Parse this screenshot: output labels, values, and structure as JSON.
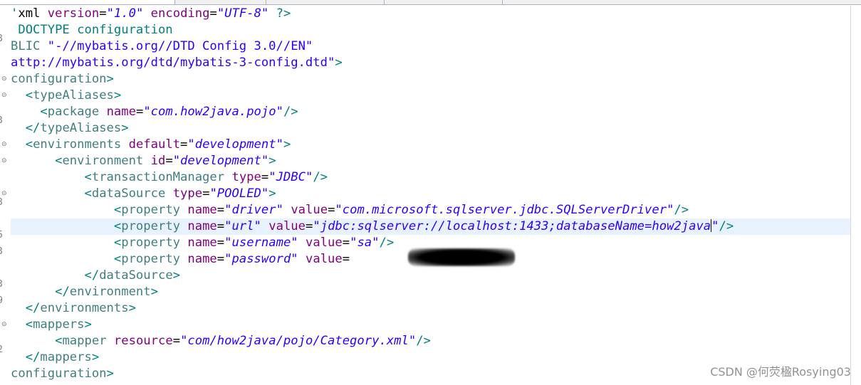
{
  "editor": {
    "lines": [
      {
        "tokens": [
          {
            "t": "punct",
            "v": "'"
          },
          {
            "t": "plain",
            "v": "xml "
          },
          {
            "t": "attr",
            "v": "version"
          },
          {
            "t": "plain",
            "v": "="
          },
          {
            "t": "val",
            "v": "\"1.0\""
          },
          {
            "t": "plain",
            "v": " "
          },
          {
            "t": "attr",
            "v": "encoding"
          },
          {
            "t": "plain",
            "v": "="
          },
          {
            "t": "val",
            "v": "\"UTF-8\""
          },
          {
            "t": "plain",
            "v": " "
          },
          {
            "t": "punct",
            "v": "?>"
          }
        ]
      },
      {
        "tokens": [
          {
            "t": "doctype",
            "v": " DOCTYPE configuration"
          }
        ]
      },
      {
        "tokens": [
          {
            "t": "dt-text",
            "v": "BLIC "
          },
          {
            "t": "dt-str",
            "v": "\"-//mybatis.org//DTD Config 3.0//EN\""
          }
        ]
      },
      {
        "tokens": [
          {
            "t": "dt-str",
            "v": "attp://mybatis.org/dtd/mybatis-3-config.dtd\""
          },
          {
            "t": "doctype",
            "v": ">"
          }
        ]
      },
      {
        "tokens": [
          {
            "t": "tag",
            "v": "configuration"
          },
          {
            "t": "punct",
            "v": ">"
          }
        ]
      },
      {
        "tokens": [
          {
            "t": "plain",
            "v": "  "
          },
          {
            "t": "punct",
            "v": "<"
          },
          {
            "t": "tag",
            "v": "typeAliases"
          },
          {
            "t": "punct",
            "v": ">"
          }
        ]
      },
      {
        "tokens": [
          {
            "t": "plain",
            "v": "    "
          },
          {
            "t": "punct",
            "v": "<"
          },
          {
            "t": "tag",
            "v": "package"
          },
          {
            "t": "plain",
            "v": " "
          },
          {
            "t": "attr",
            "v": "name"
          },
          {
            "t": "plain",
            "v": "="
          },
          {
            "t": "val",
            "v": "\"com.how2java.pojo\""
          },
          {
            "t": "punct",
            "v": "/>"
          }
        ]
      },
      {
        "tokens": [
          {
            "t": "plain",
            "v": "  "
          },
          {
            "t": "punct",
            "v": "</"
          },
          {
            "t": "tag",
            "v": "typeAliases"
          },
          {
            "t": "punct",
            "v": ">"
          }
        ]
      },
      {
        "tokens": [
          {
            "t": "plain",
            "v": "  "
          },
          {
            "t": "punct",
            "v": "<"
          },
          {
            "t": "tag",
            "v": "environments"
          },
          {
            "t": "plain",
            "v": " "
          },
          {
            "t": "attr",
            "v": "default"
          },
          {
            "t": "plain",
            "v": "="
          },
          {
            "t": "val",
            "v": "\"development\""
          },
          {
            "t": "punct",
            "v": ">"
          }
        ]
      },
      {
        "tokens": [
          {
            "t": "plain",
            "v": "      "
          },
          {
            "t": "punct",
            "v": "<"
          },
          {
            "t": "tag",
            "v": "environment"
          },
          {
            "t": "plain",
            "v": " "
          },
          {
            "t": "attr",
            "v": "id"
          },
          {
            "t": "plain",
            "v": "="
          },
          {
            "t": "val",
            "v": "\"development\""
          },
          {
            "t": "punct",
            "v": ">"
          }
        ]
      },
      {
        "tokens": [
          {
            "t": "plain",
            "v": "          "
          },
          {
            "t": "punct",
            "v": "<"
          },
          {
            "t": "tag",
            "v": "transactionManager"
          },
          {
            "t": "plain",
            "v": " "
          },
          {
            "t": "attr",
            "v": "type"
          },
          {
            "t": "plain",
            "v": "="
          },
          {
            "t": "val",
            "v": "\"JDBC\""
          },
          {
            "t": "punct",
            "v": "/>"
          }
        ]
      },
      {
        "tokens": [
          {
            "t": "plain",
            "v": "          "
          },
          {
            "t": "punct",
            "v": "<"
          },
          {
            "t": "tag",
            "v": "dataSource"
          },
          {
            "t": "plain",
            "v": " "
          },
          {
            "t": "attr",
            "v": "type"
          },
          {
            "t": "plain",
            "v": "="
          },
          {
            "t": "val",
            "v": "\"POOLED\""
          },
          {
            "t": "punct",
            "v": ">"
          }
        ]
      },
      {
        "tokens": [
          {
            "t": "plain",
            "v": "              "
          },
          {
            "t": "punct",
            "v": "<"
          },
          {
            "t": "tag",
            "v": "property"
          },
          {
            "t": "plain",
            "v": " "
          },
          {
            "t": "attr",
            "v": "name"
          },
          {
            "t": "plain",
            "v": "="
          },
          {
            "t": "val",
            "v": "\"driver\""
          },
          {
            "t": "plain",
            "v": " "
          },
          {
            "t": "attr",
            "v": "value"
          },
          {
            "t": "plain",
            "v": "="
          },
          {
            "t": "val",
            "v": "\"com.microsoft.sqlserver.jdbc.SQLServerDriver\""
          },
          {
            "t": "punct",
            "v": "/>"
          }
        ]
      },
      {
        "current": true,
        "tokens": [
          {
            "t": "plain",
            "v": "              "
          },
          {
            "t": "punct",
            "v": "<"
          },
          {
            "t": "tag",
            "v": "property"
          },
          {
            "t": "plain",
            "v": " "
          },
          {
            "t": "attr",
            "v": "name"
          },
          {
            "t": "plain",
            "v": "="
          },
          {
            "t": "val",
            "v": "\"url\""
          },
          {
            "t": "plain",
            "v": " "
          },
          {
            "t": "attr",
            "v": "value"
          },
          {
            "t": "plain",
            "v": "="
          },
          {
            "t": "val",
            "v": "\"jdbc:sqlserver://localhost:1433;databaseName=how2java"
          },
          {
            "t": "caret",
            "v": ""
          },
          {
            "t": "val",
            "v": "\""
          },
          {
            "t": "punct",
            "v": "/>"
          }
        ]
      },
      {
        "tokens": [
          {
            "t": "plain",
            "v": "              "
          },
          {
            "t": "punct",
            "v": "<"
          },
          {
            "t": "tag",
            "v": "property"
          },
          {
            "t": "plain",
            "v": " "
          },
          {
            "t": "attr",
            "v": "name"
          },
          {
            "t": "plain",
            "v": "="
          },
          {
            "t": "val",
            "v": "\"username\""
          },
          {
            "t": "plain",
            "v": " "
          },
          {
            "t": "attr",
            "v": "value"
          },
          {
            "t": "plain",
            "v": "="
          },
          {
            "t": "val",
            "v": "\"sa\""
          },
          {
            "t": "punct",
            "v": "/>"
          }
        ]
      },
      {
        "tokens": [
          {
            "t": "plain",
            "v": "              "
          },
          {
            "t": "punct",
            "v": "<"
          },
          {
            "t": "tag",
            "v": "property"
          },
          {
            "t": "plain",
            "v": " "
          },
          {
            "t": "attr",
            "v": "name"
          },
          {
            "t": "plain",
            "v": "="
          },
          {
            "t": "val",
            "v": "\"password\""
          },
          {
            "t": "plain",
            "v": " "
          },
          {
            "t": "attr",
            "v": "value"
          },
          {
            "t": "plain",
            "v": "=            "
          },
          {
            "t": "punct",
            "v": "/>"
          }
        ]
      },
      {
        "tokens": [
          {
            "t": "plain",
            "v": "          "
          },
          {
            "t": "punct",
            "v": "</"
          },
          {
            "t": "tag",
            "v": "dataSource"
          },
          {
            "t": "punct",
            "v": ">"
          }
        ]
      },
      {
        "tokens": [
          {
            "t": "plain",
            "v": "      "
          },
          {
            "t": "punct",
            "v": "</"
          },
          {
            "t": "tag",
            "v": "environment"
          },
          {
            "t": "punct",
            "v": ">"
          }
        ]
      },
      {
        "tokens": [
          {
            "t": "plain",
            "v": "  "
          },
          {
            "t": "punct",
            "v": "</"
          },
          {
            "t": "tag",
            "v": "environments"
          },
          {
            "t": "punct",
            "v": ">"
          }
        ]
      },
      {
        "tokens": [
          {
            "t": "plain",
            "v": "  "
          },
          {
            "t": "punct",
            "v": "<"
          },
          {
            "t": "tag",
            "v": "mappers"
          },
          {
            "t": "punct",
            "v": ">"
          }
        ]
      },
      {
        "tokens": [
          {
            "t": "plain",
            "v": "      "
          },
          {
            "t": "punct",
            "v": "<"
          },
          {
            "t": "tag",
            "v": "mapper"
          },
          {
            "t": "plain",
            "v": " "
          },
          {
            "t": "attr",
            "v": "resource"
          },
          {
            "t": "plain",
            "v": "="
          },
          {
            "t": "val",
            "v": "\"com/how2java/pojo/Category.xml\""
          },
          {
            "t": "punct",
            "v": "/>"
          }
        ]
      },
      {
        "tokens": [
          {
            "t": "plain",
            "v": "  "
          },
          {
            "t": "punct",
            "v": "</"
          },
          {
            "t": "tag",
            "v": "mappers"
          },
          {
            "t": "punct",
            "v": ">"
          }
        ]
      },
      {
        "tokens": [
          {
            "t": "tag",
            "v": "configuration"
          },
          {
            "t": "punct",
            "v": ">"
          }
        ]
      }
    ]
  },
  "gutter": {
    "line_numbers": [
      "",
      "",
      "3",
      "",
      "",
      "",
      "",
      "3",
      "",
      "",
      "",
      "",
      "3",
      "",
      "5",
      "3",
      "",
      "3",
      "9",
      "",
      "",
      "2",
      "",
      ""
    ],
    "fold_markers": [
      4,
      5,
      8,
      9,
      11,
      19
    ]
  },
  "redaction": {
    "description_hidden": true
  },
  "watermark": {
    "text": "CSDN @何荧楹Rosying03"
  },
  "colors": {
    "tag": "#3f7f7f",
    "attribute": "#7f007f",
    "value": "#2a00ff",
    "punctuation": "#008080",
    "current_line": "#e8f2fe"
  }
}
